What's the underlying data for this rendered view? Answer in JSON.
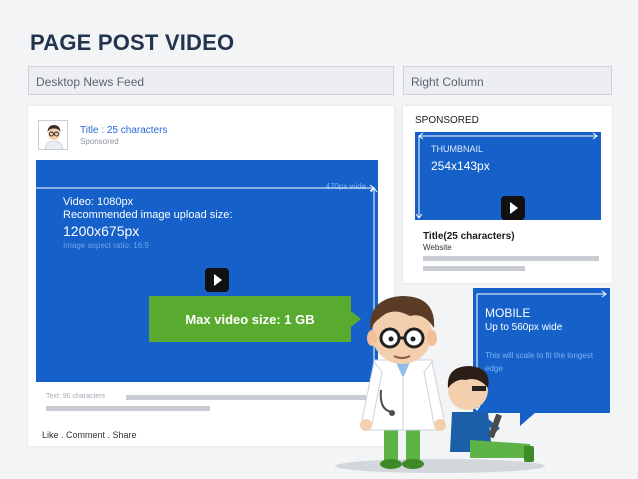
{
  "page": {
    "title": "PAGE POST VIDEO"
  },
  "sections": {
    "left_label": "Desktop News Feed",
    "right_label": "Right Column"
  },
  "feed_post": {
    "title": "Title : 25 characters",
    "subtitle": "Sponsored",
    "width_label": "470px wide",
    "video_line1": "Video: 1080px",
    "video_line2": "Recommended image upload size:",
    "upload_size": "1200x675px",
    "aspect_ratio": "Image aspect ratio: 16:9",
    "max_size": "Max video size: 1 GB",
    "text_note": "Text: 90 characters",
    "actions": "Like  .  Comment  .  Share"
  },
  "right_column": {
    "sponsored": "SPONSORED",
    "thumb_label": "THUMBNAIL",
    "thumb_size": "254x143px",
    "title": "Title(25 characters)",
    "site": "Website"
  },
  "mobile": {
    "heading": "MOBILE",
    "sub": "Up to 560px wide",
    "note": "This will scale to fit the longest edge"
  },
  "colors": {
    "blue": "#1561c9",
    "green": "#59ab2f",
    "title": "#23344f"
  }
}
